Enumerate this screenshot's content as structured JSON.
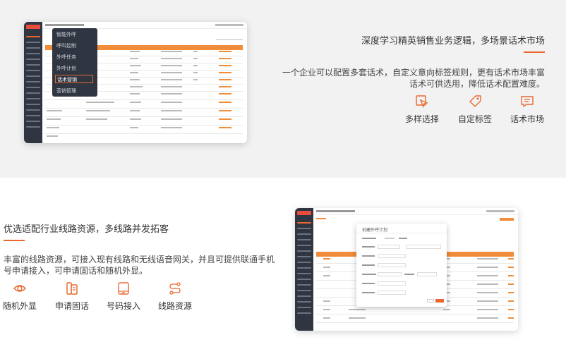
{
  "section1": {
    "title": "深度学习精英销售业务逻辑，多场景话术市场",
    "description": "一个企业可以配置多套话术，自定义意向标签规则，更有话术市场丰富话术可供选用，降低话术配置难度。",
    "features": [
      {
        "label": "多样选择",
        "icon": "cursor-click-icon"
      },
      {
        "label": "自定标签",
        "icon": "tag-icon"
      },
      {
        "label": "话术市场",
        "icon": "chat-bubble-icon"
      }
    ],
    "screenshot": {
      "popup_menu": [
        "智能外呼",
        "呼叫控制",
        "外呼任务",
        "外呼计划",
        "话术营销",
        "营销管理"
      ],
      "selected_item": "话术营销"
    }
  },
  "section2": {
    "title": "优选适配行业线路资源，多线路并发拓客",
    "description": "丰富的线路资源，可接入现有线路和无线语音网关，并且可提供联通手机号申请接入，可申请固话和随机外显。",
    "features": [
      {
        "label": "随机外显",
        "icon": "eye-icon"
      },
      {
        "label": "申请固话",
        "icon": "desk-phone-icon"
      },
      {
        "label": "号码接入",
        "icon": "mobile-phone-icon"
      },
      {
        "label": "线路资源",
        "icon": "route-icon"
      }
    ],
    "screenshot": {
      "dialog_title": "创建外呼计划"
    }
  },
  "colors": {
    "accent": "#e8682f",
    "sidebar": "#2f3541",
    "table_header": "#f08c3a"
  }
}
